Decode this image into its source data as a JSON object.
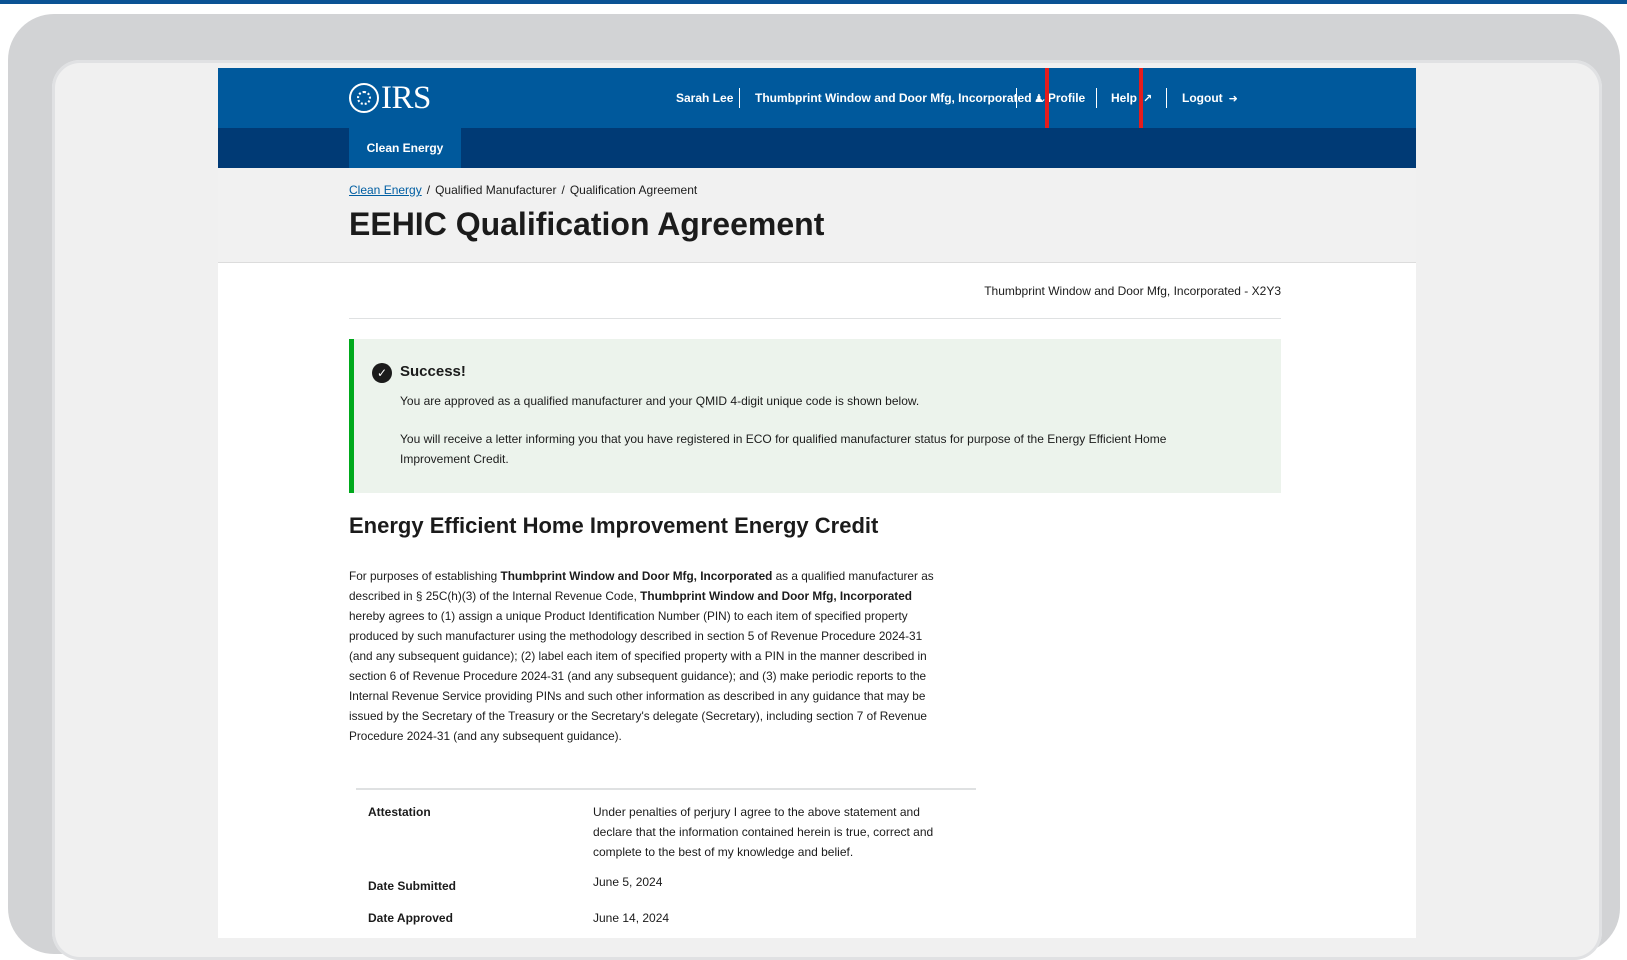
{
  "header": {
    "logo_text": "IRS",
    "user_name": "Sarah Lee",
    "company_menu": "Thumbprint Window and Door Mfg, Incorporated",
    "profile_label": "Profile",
    "help_label": "Help",
    "logout_label": "Logout"
  },
  "subnav": {
    "active_tab": "Clean Energy"
  },
  "breadcrumb": {
    "items": [
      "Clean Energy",
      "Qualified Manufacturer",
      "Qualification Agreement"
    ],
    "separator": "/"
  },
  "page_title": "EEHIC Qualification Agreement",
  "company_line": "Thumbprint Window and Door Mfg, Incorporated - X2Y3",
  "alert": {
    "title": "Success!",
    "line1": "You are approved as a qualified manufacturer and your QMID 4-digit unique code is shown below.",
    "line2": "You will receive a letter informing you that you have registered in ECO for qualified manufacturer status for purpose of the Energy Efficient Home Improvement Credit."
  },
  "section": {
    "heading": "Energy Efficient Home Improvement Energy Credit",
    "p_prefix": "For purposes of establishing ",
    "p_company1": "Thumbprint Window and Door Mfg, Incorporated",
    "p_mid": " as a qualified manufacturer as described in § 25C(h)(3) of the Internal Revenue Code, ",
    "p_company2": "Thumbprint Window and Door Mfg, Incorporated",
    "p_rest": " hereby agrees to (1) assign a unique Product Identification Number (PIN) to each item of specified property produced by such manufacturer using the methodology described in section 5 of Revenue Procedure 2024-31 (and any subsequent guidance); (2) label each item of specified property with a PIN in the manner described in section 6 of Revenue Procedure 2024-31 (and any subsequent guidance); and (3) make periodic reports to the Internal Revenue Service providing PINs and such other information as described in any guidance that may be issued by the Secretary of the Treasury or the Secretary's delegate (Secretary), including section 7 of Revenue Procedure 2024-31 (and any subsequent guidance)."
  },
  "details": {
    "attestation_label": "Attestation",
    "attestation_value": "Under penalties of perjury I agree to the above statement and declare that the information contained herein is true, correct and complete to the best of my knowledge and belief.",
    "date_submitted_label": "Date Submitted",
    "date_submitted_value": "June 5, 2024",
    "date_approved_label": "Date Approved",
    "date_approved_value": "June 14, 2024"
  },
  "colors": {
    "header_blue": "#00599c",
    "subnav_navy": "#003a75",
    "success_green": "#00a91c",
    "alert_bg": "#ecf3ec",
    "highlight_red": "#e51c1c"
  }
}
